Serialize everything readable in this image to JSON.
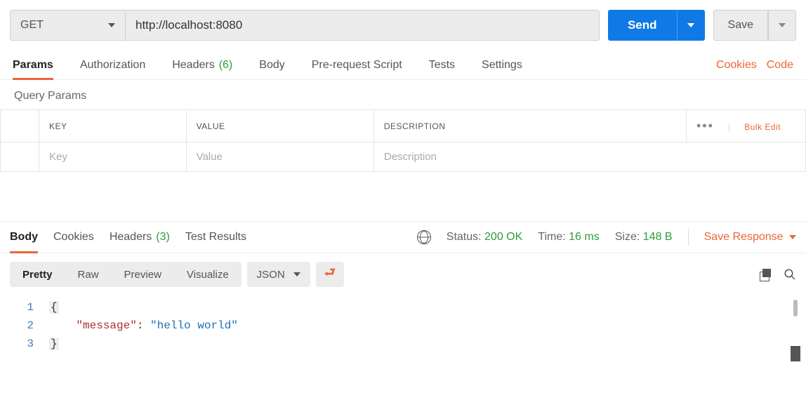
{
  "request": {
    "method": "GET",
    "url": "http://localhost:8080",
    "send_label": "Send",
    "save_label": "Save"
  },
  "request_tabs": {
    "params": "Params",
    "authorization": "Authorization",
    "headers": "Headers",
    "headers_count": "(6)",
    "body": "Body",
    "prerequest": "Pre-request Script",
    "tests": "Tests",
    "settings": "Settings",
    "cookies_link": "Cookies",
    "code_link": "Code"
  },
  "query_params": {
    "title": "Query Params",
    "col_key": "KEY",
    "col_value": "VALUE",
    "col_description": "DESCRIPTION",
    "bulk_edit": "Bulk Edit",
    "placeholder_key": "Key",
    "placeholder_value": "Value",
    "placeholder_description": "Description"
  },
  "response_tabs": {
    "body": "Body",
    "cookies": "Cookies",
    "headers": "Headers",
    "headers_count": "(3)",
    "test_results": "Test Results"
  },
  "response_meta": {
    "status_label": "Status:",
    "status_value": "200 OK",
    "time_label": "Time:",
    "time_value": "16 ms",
    "size_label": "Size:",
    "size_value": "148 B",
    "save_response": "Save Response"
  },
  "response_toolbar": {
    "pretty": "Pretty",
    "raw": "Raw",
    "preview": "Preview",
    "visualize": "Visualize",
    "format": "JSON"
  },
  "response_body": {
    "line1_num": "1",
    "line1_text": "{",
    "line2_num": "2",
    "line2_key": "\"message\"",
    "line2_colon": ": ",
    "line2_val": "\"hello world\"",
    "line3_num": "3",
    "line3_text": "}"
  }
}
